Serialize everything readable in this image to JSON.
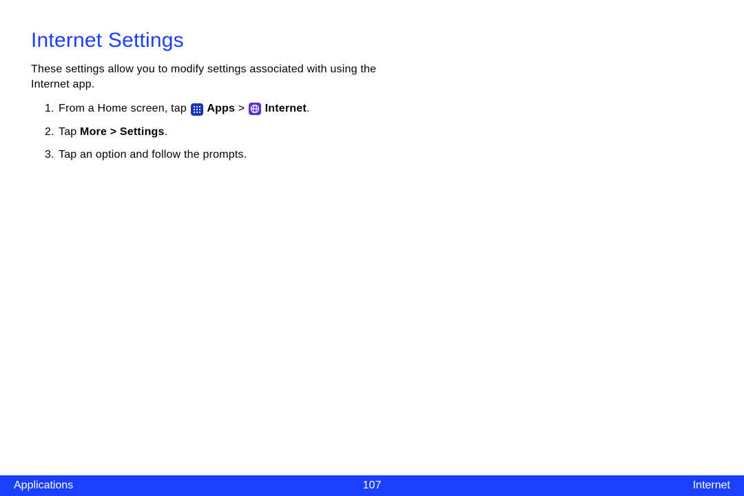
{
  "title": "Internet Settings",
  "intro": "These settings allow you to modify settings associated with using the Internet app.",
  "steps": {
    "s1": {
      "num": "1.",
      "pre": "From a Home screen, tap ",
      "apps": "Apps",
      "sep": " > ",
      "internet": "Internet",
      "end": "."
    },
    "s2": {
      "num": "2.",
      "pre": "Tap ",
      "more": "More > Settings",
      "end": "."
    },
    "s3": {
      "num": "3.",
      "text": "Tap an option and follow the prompts."
    }
  },
  "footer": {
    "left": "Applications",
    "center": "107",
    "right": "Internet"
  }
}
